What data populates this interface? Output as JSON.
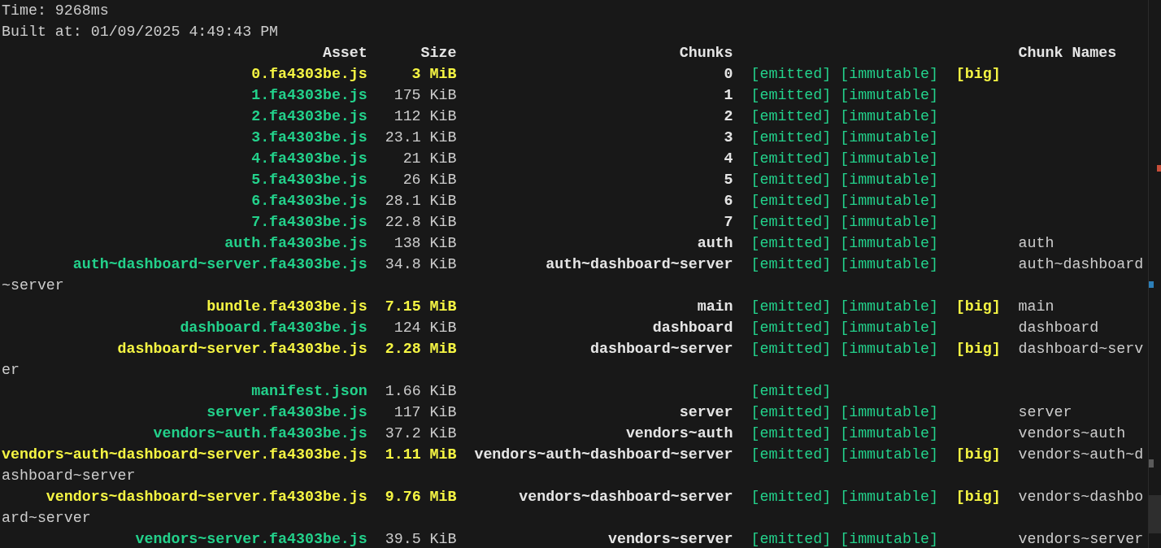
{
  "summary": [
    {
      "text": "Time: 9268ms"
    },
    {
      "text": "Built at: 01/09/2025 4:49:43 PM"
    }
  ],
  "columns": {
    "asset": "Asset",
    "size": "Size",
    "chunks": "Chunks",
    "chunk_names": "Chunk Names"
  },
  "rows": [
    {
      "asset": "0.fa4303be.js",
      "size": "3 MiB",
      "oversized": true,
      "chunks": "0",
      "emitted": "[emitted]",
      "immutable": "[immutable]",
      "big": "[big]"
    },
    {
      "asset": "1.fa4303be.js",
      "size": "175 KiB",
      "oversized": false,
      "chunks": "1",
      "emitted": "[emitted]",
      "immutable": "[immutable]"
    },
    {
      "asset": "2.fa4303be.js",
      "size": "112 KiB",
      "oversized": false,
      "chunks": "2",
      "emitted": "[emitted]",
      "immutable": "[immutable]"
    },
    {
      "asset": "3.fa4303be.js",
      "size": "23.1 KiB",
      "oversized": false,
      "chunks": "3",
      "emitted": "[emitted]",
      "immutable": "[immutable]"
    },
    {
      "asset": "4.fa4303be.js",
      "size": "21 KiB",
      "oversized": false,
      "chunks": "4",
      "emitted": "[emitted]",
      "immutable": "[immutable]"
    },
    {
      "asset": "5.fa4303be.js",
      "size": "26 KiB",
      "oversized": false,
      "chunks": "5",
      "emitted": "[emitted]",
      "immutable": "[immutable]"
    },
    {
      "asset": "6.fa4303be.js",
      "size": "28.1 KiB",
      "oversized": false,
      "chunks": "6",
      "emitted": "[emitted]",
      "immutable": "[immutable]"
    },
    {
      "asset": "7.fa4303be.js",
      "size": "22.8 KiB",
      "oversized": false,
      "chunks": "7",
      "emitted": "[emitted]",
      "immutable": "[immutable]"
    },
    {
      "asset": "auth.fa4303be.js",
      "size": "138 KiB",
      "oversized": false,
      "chunks": "auth",
      "emitted": "[emitted]",
      "immutable": "[immutable]",
      "chunk_names": "auth"
    },
    {
      "asset": "auth~dashboard~server.fa4303be.js",
      "size": "34.8 KiB",
      "oversized": false,
      "chunks": "auth~dashboard~server",
      "emitted": "[emitted]",
      "immutable": "[immutable]",
      "chunk_names": "auth~dashboard~server"
    },
    {
      "asset": "bundle.fa4303be.js",
      "size": "7.15 MiB",
      "oversized": true,
      "chunks": "main",
      "emitted": "[emitted]",
      "immutable": "[immutable]",
      "big": "[big]",
      "chunk_names": "main"
    },
    {
      "asset": "dashboard.fa4303be.js",
      "size": "124 KiB",
      "oversized": false,
      "chunks": "dashboard",
      "emitted": "[emitted]",
      "immutable": "[immutable]",
      "chunk_names": "dashboard"
    },
    {
      "asset": "dashboard~server.fa4303be.js",
      "size": "2.28 MiB",
      "oversized": true,
      "chunks": "dashboard~server",
      "emitted": "[emitted]",
      "immutable": "[immutable]",
      "big": "[big]",
      "chunk_names": "dashboard~server"
    },
    {
      "asset": "manifest.json",
      "size": "1.66 KiB",
      "oversized": false,
      "emitted": "[emitted]"
    },
    {
      "asset": "server.fa4303be.js",
      "size": "117 KiB",
      "oversized": false,
      "chunks": "server",
      "emitted": "[emitted]",
      "immutable": "[immutable]",
      "chunk_names": "server"
    },
    {
      "asset": "vendors~auth.fa4303be.js",
      "size": "37.2 KiB",
      "oversized": false,
      "chunks": "vendors~auth",
      "emitted": "[emitted]",
      "immutable": "[immutable]",
      "chunk_names": "vendors~auth"
    },
    {
      "asset": "vendors~auth~dashboard~server.fa4303be.js",
      "size": "1.11 MiB",
      "oversized": true,
      "chunks": "vendors~auth~dashboard~server",
      "emitted": "[emitted]",
      "immutable": "[immutable]",
      "big": "[big]",
      "chunk_names": "vendors~auth~dashboard~server"
    },
    {
      "asset": "vendors~dashboard~server.fa4303be.js",
      "size": "9.76 MiB",
      "oversized": true,
      "chunks": "vendors~dashboard~server",
      "emitted": "[emitted]",
      "immutable": "[immutable]",
      "big": "[big]",
      "chunk_names": "vendors~dashboard~server"
    },
    {
      "asset": "vendors~server.fa4303be.js",
      "size": "39.5 KiB",
      "oversized": false,
      "chunks": "vendors~server",
      "emitted": "[emitted]",
      "immutable": "[immutable]",
      "chunk_names": "vendors~server"
    }
  ]
}
